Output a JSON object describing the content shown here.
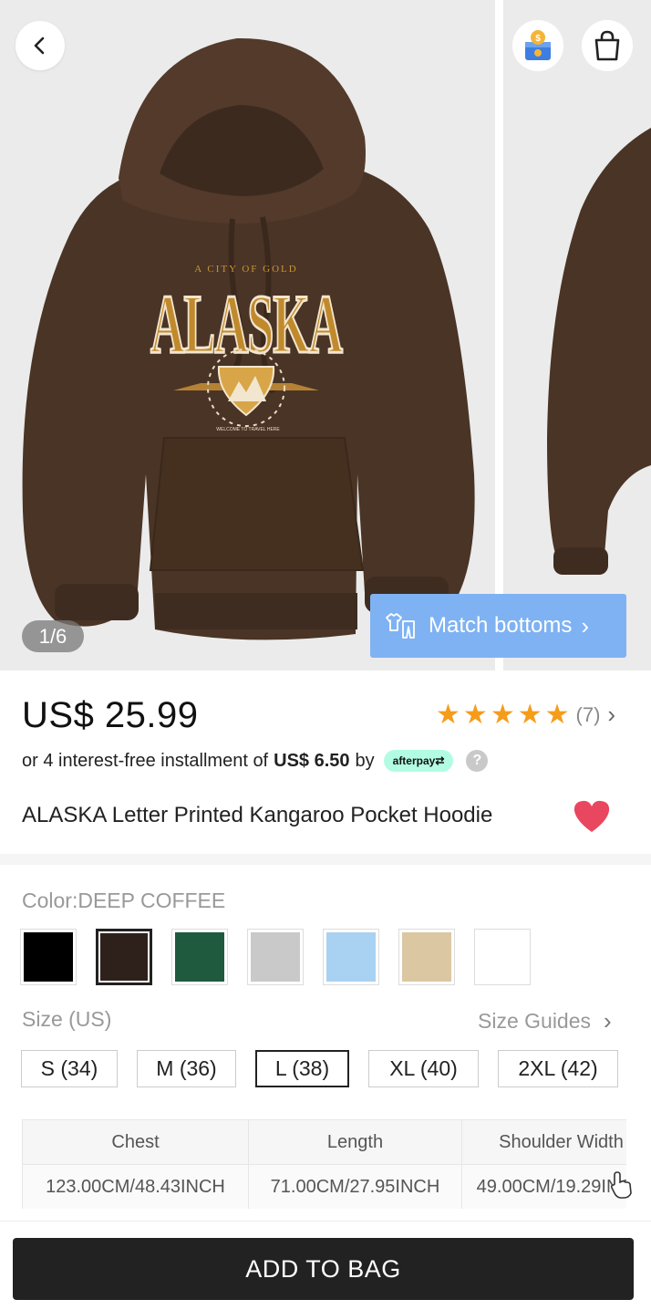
{
  "gallery": {
    "counter": "1/6",
    "match_button_label": "Match bottoms",
    "print_top": "A CITY OF GOLD",
    "print_main": "ALASKA",
    "print_bottom": "WELCOME TO TRAVEL HERE"
  },
  "product": {
    "price": "US$ 25.99",
    "rating_stars": 5,
    "review_count": "(7)",
    "installment_prefix": "or 4 interest-free installment of",
    "installment_amount": "US$ 6.50",
    "installment_by": "by",
    "afterpay_label": "afterpay",
    "help_symbol": "?",
    "title": "ALASKA Letter Printed Kangaroo Pocket Hoodie",
    "favorited": true
  },
  "color": {
    "label": "Color:DEEP COFFEE",
    "swatches": [
      {
        "name": "black",
        "hex": "#000000",
        "selected": false
      },
      {
        "name": "deep-coffee",
        "hex": "#2e211b",
        "selected": true
      },
      {
        "name": "green",
        "hex": "#1f5a3f",
        "selected": false
      },
      {
        "name": "grey",
        "hex": "#c9c9c9",
        "selected": false
      },
      {
        "name": "light-blue",
        "hex": "#a9d1f1",
        "selected": false
      },
      {
        "name": "apricot",
        "hex": "#dcc7a3",
        "selected": false
      },
      {
        "name": "white",
        "hex": "#ffffff",
        "selected": false
      }
    ]
  },
  "size": {
    "label": "Size (US)",
    "guide_label": "Size Guides",
    "options": [
      "S (34)",
      "M (36)",
      "L (38)",
      "XL (40)",
      "2XL (42)"
    ],
    "selected": "L (38)"
  },
  "measurements": {
    "headers": [
      "Chest",
      "Length",
      "Shoulder Width"
    ],
    "values": [
      "123.00CM/48.43INCH",
      "71.00CM/27.95INCH",
      "49.00CM/19.29INCH"
    ]
  },
  "cta": {
    "add_to_bag": "ADD TO BAG"
  },
  "colors": {
    "accent_star": "#f59c1a",
    "heart": "#e8475f",
    "match_button": "#7fb2f2",
    "afterpay_bg": "#b2fce4",
    "cta_bg": "#222222"
  },
  "icons": {
    "back": "chevron-left-icon",
    "coin": "coin-reward-icon",
    "bag": "shopping-bag-icon",
    "match": "outfit-icon",
    "heart": "heart-icon"
  }
}
